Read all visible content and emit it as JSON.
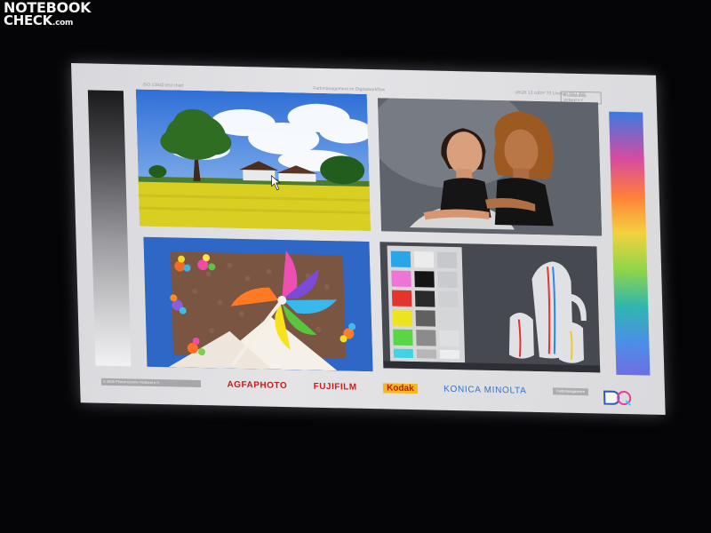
{
  "watermark": {
    "line1": "NOTEBOOK",
    "line2_main": "CHECK",
    "line2_suffix": ".com"
  },
  "screen": {
    "header": {
      "left_text": "ISO 12640 test chart",
      "middle_text": "Farbmanagement im Digitalworkflow",
      "right_text": "sRGB 13 cd/m² 70 Lines/in ISO 300"
    },
    "brand_box_text": "Photoindustrie-Verband e.V.",
    "logos": {
      "copyright": "© 2005 Photoindustrie-Verband e.V.",
      "agfa": "AGFAPHOTO",
      "fujifilm": "FUJIFILM",
      "kodak": "Kodak",
      "konica": "KONICA MINOLTA",
      "small_right": "Farbmanagement"
    }
  },
  "colors": {
    "agfa_red": "#c51a1a",
    "fuji_red": "#d11a1a",
    "kodak_yellow": "#f5b81d",
    "konica_blue": "#2f73c6"
  },
  "icons": {
    "dq_logo": "dq-logo-icon",
    "mouse_pointer": "mouse-pointer-icon"
  }
}
